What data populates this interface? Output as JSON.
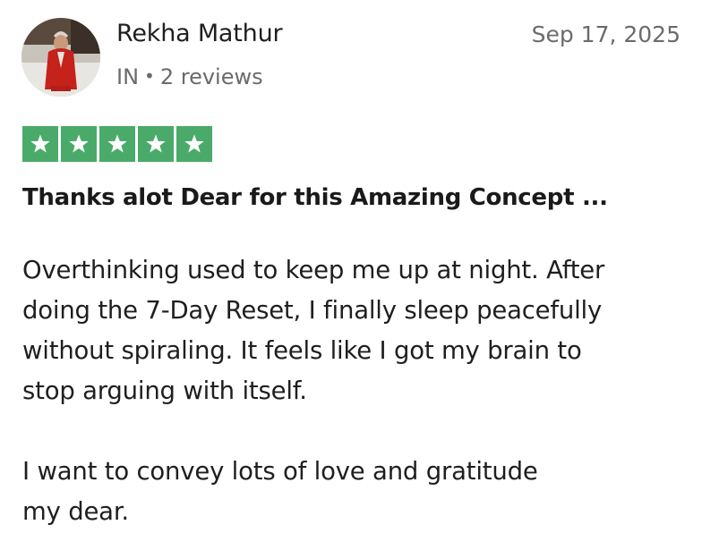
{
  "reviewer": {
    "name": "Rekha Mathur",
    "country": "IN",
    "separator": "•",
    "review_count": "2 reviews",
    "avatar_icon": "person-photo-avatar"
  },
  "review": {
    "date": "Sep 17, 2025",
    "rating": 5,
    "rating_max": 5,
    "star_color": "#4aaa6a",
    "title": "Thanks alot Dear for this Amazing Concept ...",
    "paragraphs": [
      {
        "lines": [
          "Overthinking used to keep me up at night. After",
          "doing the 7-Day Reset, I finally sleep peacefully",
          "without spiraling. It feels like I got my brain to",
          "stop arguing with itself."
        ]
      },
      {
        "lines": [
          "I want to convey lots of love and gratitude",
          "my dear."
        ]
      }
    ]
  }
}
